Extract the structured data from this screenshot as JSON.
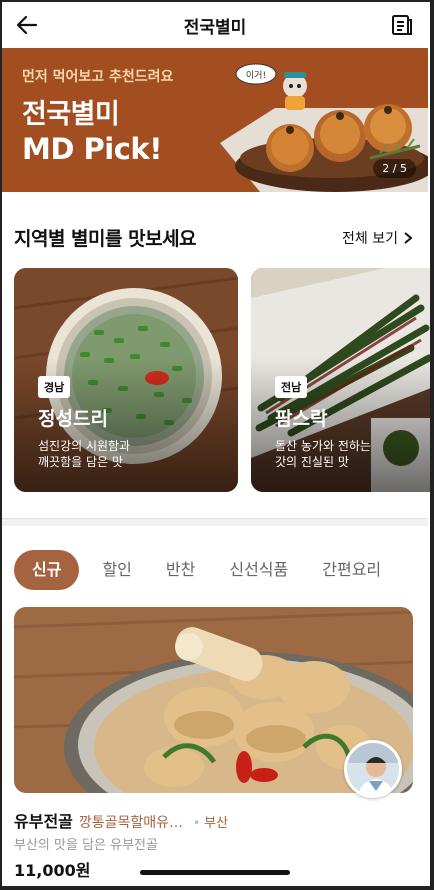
{
  "header": {
    "title": "전국별미",
    "back_icon": "arrow-left-icon",
    "menu_icon": "document-list-icon"
  },
  "banner": {
    "subtitle": "먼저 먹어보고 추천드려요",
    "title_line1": "전국별미",
    "title_line2": "MD Pick!",
    "speech": "이거!",
    "pager": "2 / 5",
    "bg_color": "#a24e21"
  },
  "regional": {
    "heading": "지역별 별미를 맛보세요",
    "view_all": "전체 보기",
    "cards": [
      {
        "region": "경남",
        "name": "정성드리",
        "desc_line1": "섬진강의 시원함과",
        "desc_line2": "깨끗함을 담은 맛"
      },
      {
        "region": "전남",
        "name": "팜스락",
        "desc_line1": "돌산 농가와 전하는",
        "desc_line2": "갓의 진실된 맛"
      }
    ]
  },
  "tabs": [
    {
      "label": "신규",
      "active": true
    },
    {
      "label": "할인",
      "active": false
    },
    {
      "label": "반찬",
      "active": false
    },
    {
      "label": "신선식품",
      "active": false
    },
    {
      "label": "간편요리",
      "active": false
    }
  ],
  "product": {
    "name": "유부전골",
    "shop": "깡통골목할매유…",
    "dot": "•",
    "region": "부산",
    "description": "부산의 맛을 담은 유부전골",
    "price": "11,000원"
  },
  "colors": {
    "accent": "#a6633f",
    "text": "#111111"
  }
}
